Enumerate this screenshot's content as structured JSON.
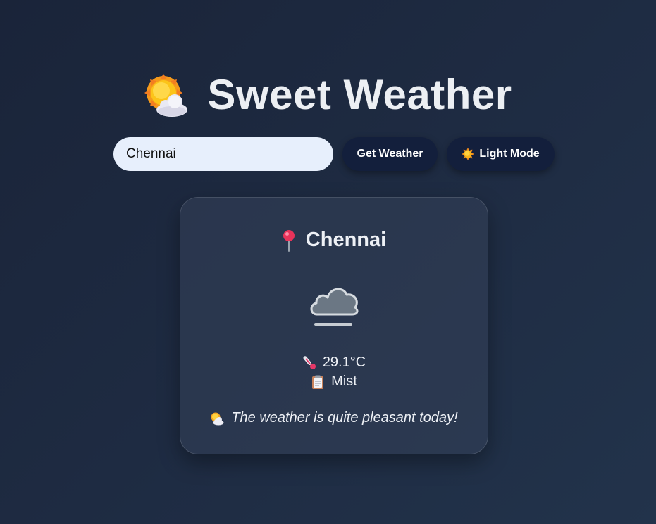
{
  "app": {
    "title": "Sweet Weather",
    "logo_icon": "sun-behind-cloud-icon"
  },
  "search": {
    "value": "Chennai",
    "placeholder": "",
    "get_weather_label": "Get Weather",
    "mode_label": "Light Mode",
    "mode_icon": "sun-icon"
  },
  "weather": {
    "location_icon": "round-pushpin-icon",
    "city": "Chennai",
    "condition_icon": "fog-cloud-icon",
    "temperature_icon": "thermometer-icon",
    "temperature": "29.1°C",
    "description_icon": "clipboard-icon",
    "description": "Mist",
    "message_icon": "sun-behind-cloud-icon",
    "message": "The weather is quite pleasant today!"
  },
  "colors": {
    "background": "#1e2b42",
    "button": "#131f3c",
    "input": "#e7effc",
    "pin": "#e8335a"
  }
}
